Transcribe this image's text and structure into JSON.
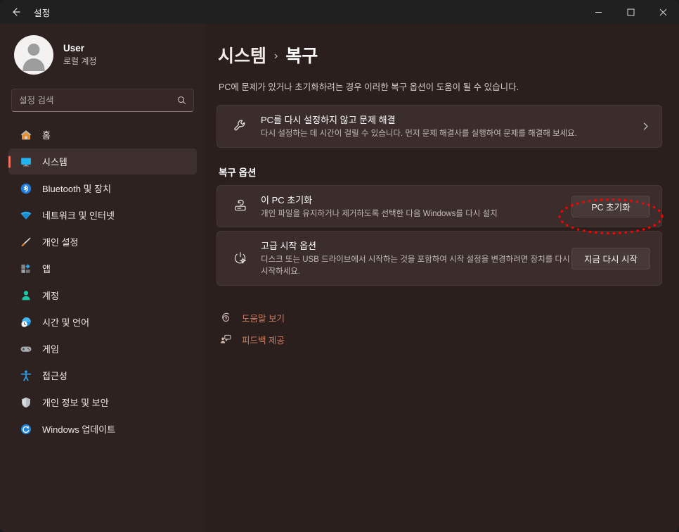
{
  "window": {
    "title": "설정",
    "back_icon": "back-arrow-icon",
    "controls": [
      {
        "name": "minimize",
        "icon": "minimize-icon"
      },
      {
        "name": "maximize",
        "icon": "maximize-icon"
      },
      {
        "name": "close",
        "icon": "close-icon"
      }
    ]
  },
  "sidebar": {
    "account": {
      "name": "User",
      "subtitle": "로컬 계정",
      "avatar_icon": "avatar-person-icon"
    },
    "search": {
      "placeholder": "설정 검색",
      "value": "",
      "icon": "search-icon"
    },
    "items": [
      {
        "label": "홈",
        "icon": "home-icon",
        "selected": false
      },
      {
        "label": "시스템",
        "icon": "system-monitor-icon",
        "selected": true
      },
      {
        "label": "Bluetooth 및 장치",
        "icon": "bluetooth-icon",
        "selected": false
      },
      {
        "label": "네트워크 및 인터넷",
        "icon": "wifi-icon",
        "selected": false
      },
      {
        "label": "개인 설정",
        "icon": "paintbrush-icon",
        "selected": false
      },
      {
        "label": "앱",
        "icon": "apps-icon",
        "selected": false
      },
      {
        "label": "계정",
        "icon": "account-person-icon",
        "selected": false
      },
      {
        "label": "시간 및 언어",
        "icon": "clock-globe-icon",
        "selected": false
      },
      {
        "label": "게임",
        "icon": "gamepad-icon",
        "selected": false
      },
      {
        "label": "접근성",
        "icon": "accessibility-icon",
        "selected": false
      },
      {
        "label": "개인 정보 및 보안",
        "icon": "shield-icon",
        "selected": false
      },
      {
        "label": "Windows 업데이트",
        "icon": "update-refresh-icon",
        "selected": false
      }
    ]
  },
  "main": {
    "breadcrumb": {
      "parent": "시스템",
      "separator": "›",
      "current": "복구"
    },
    "description": "PC에 문제가 있거나 초기화하려는 경우 이러한 복구 옵션이 도움이 될 수 있습니다.",
    "troubleshoot_card": {
      "icon": "wrench-icon",
      "title": "PC를 다시 설정하지 않고 문제 해결",
      "subtitle": "다시 설정하는 데 시간이 걸릴 수 있습니다. 먼저 문제 해결사를 실행하여 문제를 해결해 보세요.",
      "chevron_icon": "chevron-right-icon"
    },
    "section_title": "복구 옵션",
    "options": [
      {
        "icon": "pc-reset-icon",
        "title": "이 PC 초기화",
        "subtitle": "개인 파일을 유지하거나 제거하도록 선택한 다음 Windows를 다시 설치",
        "button": "PC 초기화",
        "highlighted": true
      },
      {
        "icon": "power-gear-icon",
        "title": "고급 시작 옵션",
        "subtitle": "디스크 또는 USB 드라이브에서 시작하는 것을 포함하여 시작 설정을 변경하려면 장치를 다시 시작하세요.",
        "button": "지금 다시 시작",
        "highlighted": false
      }
    ],
    "links": [
      {
        "label": "도움말 보기",
        "icon": "help-question-icon"
      },
      {
        "label": "피드백 제공",
        "icon": "feedback-icon"
      }
    ]
  },
  "annotation": {
    "shape": "dotted-ellipse",
    "target": "PC 초기화",
    "color": "#ff0000"
  },
  "colors": {
    "titlebar_bg": "#202020",
    "sidebar_bg": "#2e2220",
    "content_bg": "#2a1f1d",
    "card_bg": "#3a2d2b",
    "accent_selection": "#f0725e",
    "link": "#c97b60",
    "annotation": "#ff0000"
  }
}
